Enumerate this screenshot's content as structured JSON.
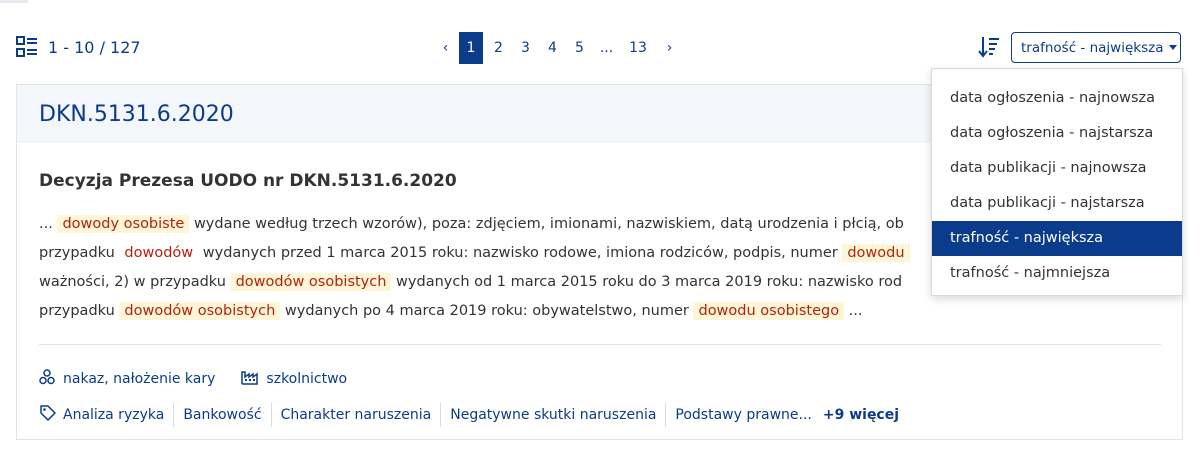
{
  "results": {
    "range": "1 - 10 / 127"
  },
  "pagination": {
    "prev": "‹",
    "next": "›",
    "pages": [
      "1",
      "2",
      "3",
      "4",
      "5",
      "...",
      "13"
    ],
    "active": "1"
  },
  "sort": {
    "selected": "trafność - największa",
    "options": [
      "data ogłoszenia - najnowsza",
      "data ogłoszenia - najstarsza",
      "data publikacji - najnowsza",
      "data publikacji - najstarsza",
      "trafność - największa",
      "trafność - najmniejsza"
    ]
  },
  "card": {
    "case_id": "DKN.5131.6.2020",
    "title": "Decyzja Prezesa UODO nr DKN.5131.6.2020",
    "line1": {
      "t1": "...",
      "h1": "dowody osobiste",
      "t2": "wydane według trzech wzorów), poza: zdjęciem, imionami, nazwiskiem, datą urodzenia i płcią, ob"
    },
    "line2": {
      "t1": "przypadku",
      "h1": "dowodów",
      "t2": "wydanych przed 1 marca 2015 roku: nazwisko rodowe, imiona rodziców, podpis, numer",
      "h2": "dowodu"
    },
    "line3": {
      "t1": "ważności, 2) w przypadku",
      "h1": "dowodów osobistych",
      "t2": "wydanych od 1 marca 2015 roku do 3 marca 2019 roku: nazwisko rod"
    },
    "line4": {
      "t1": "przypadku",
      "h1": "dowodów osobistych",
      "t2": "wydanych po 4 marca 2019 roku: obywatelstwo, numer",
      "h2": "dowodu osobistego",
      "t3": "..."
    },
    "meta": {
      "sanctions": "nakaz,  nałożenie kary",
      "sector": "szkolnictwo"
    },
    "tags": [
      "Analiza ryzyka",
      "Bankowość",
      "Charakter naruszenia",
      "Negatywne skutki naruszenia",
      "Podstawy prawne..."
    ],
    "more": "+9 więcej"
  },
  "colors": {
    "primary": "#0b3c8c",
    "highlight_bg": "#fff6d8",
    "highlight_text": "#b5230f"
  }
}
